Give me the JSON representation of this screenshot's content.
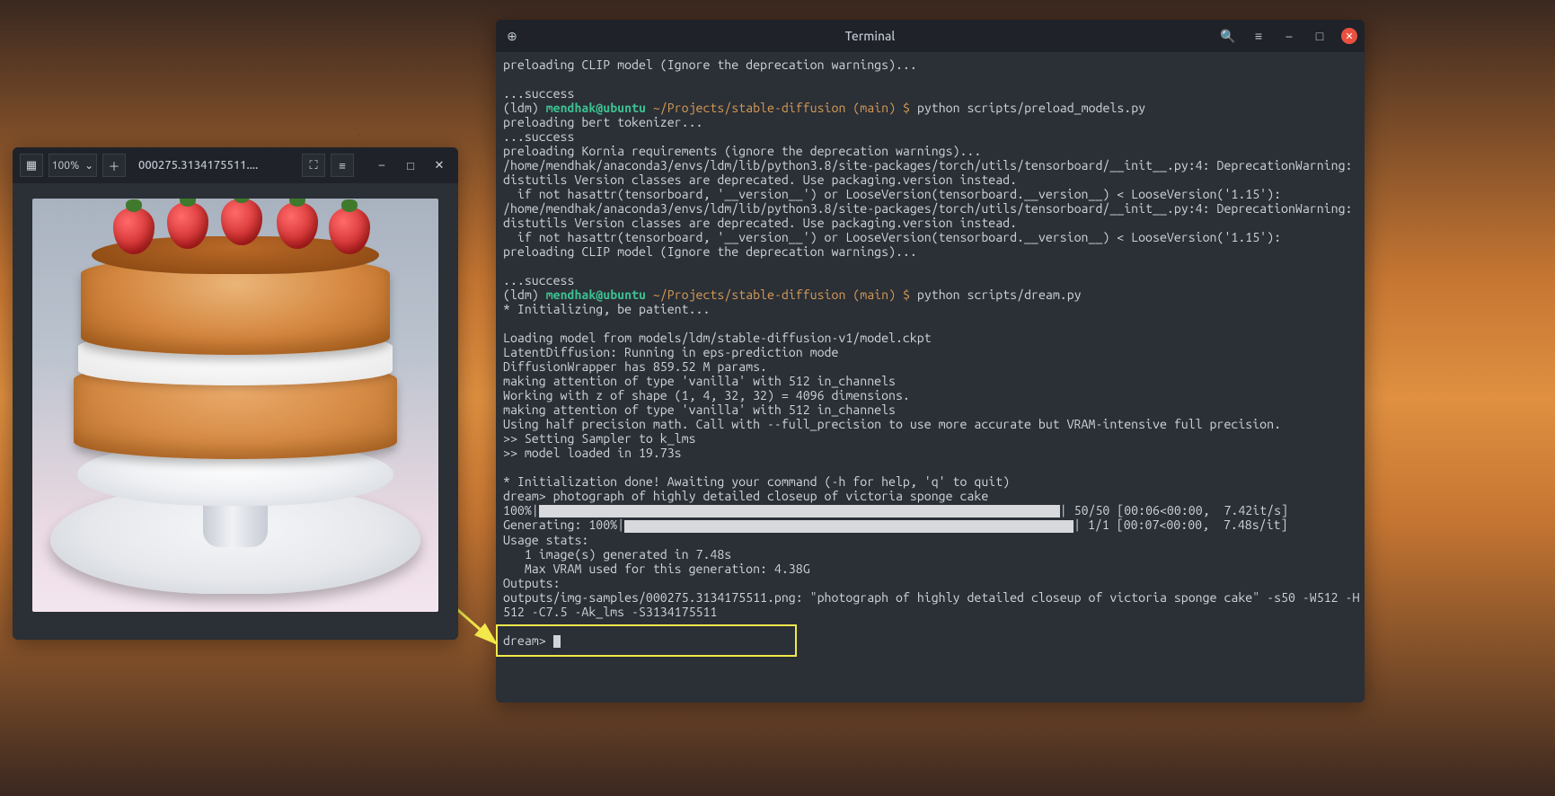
{
  "terminal": {
    "title": "Terminal",
    "prompt_env": "(ldm)",
    "prompt_userhost": "mendhak@ubuntu",
    "prompt_path": "~/Projects/stable-diffusion",
    "prompt_branch": "(main)",
    "prompt_symbol": "$",
    "lines": {
      "l01": "preloading CLIP model (Ignore the deprecation warnings)...",
      "l02": "",
      "l03": "...success",
      "cmd1": "python scripts/preload_models.py",
      "l05": "preloading bert tokenizer...",
      "l06": "...success",
      "l07": "preloading Kornia requirements (ignore the deprecation warnings)...",
      "l08": "/home/mendhak/anaconda3/envs/ldm/lib/python3.8/site-packages/torch/utils/tensorboard/__init__.py:4: DeprecationWarning:",
      "l09": "distutils Version classes are deprecated. Use packaging.version instead.",
      "l10": "  if not hasattr(tensorboard, '__version__') or LooseVersion(tensorboard.__version__) < LooseVersion('1.15'):",
      "l11": "/home/mendhak/anaconda3/envs/ldm/lib/python3.8/site-packages/torch/utils/tensorboard/__init__.py:4: DeprecationWarning:",
      "l12": "distutils Version classes are deprecated. Use packaging.version instead.",
      "l13": "  if not hasattr(tensorboard, '__version__') or LooseVersion(tensorboard.__version__) < LooseVersion('1.15'):",
      "l14": "preloading CLIP model (Ignore the deprecation warnings)...",
      "l15": "",
      "l16": "...success",
      "cmd2": "python scripts/dream.py",
      "l18": "* Initializing, be patient...",
      "l19": "",
      "l20": "Loading model from models/ldm/stable-diffusion-v1/model.ckpt",
      "l21": "LatentDiffusion: Running in eps-prediction mode",
      "l22": "DiffusionWrapper has 859.52 M params.",
      "l23": "making attention of type 'vanilla' with 512 in_channels",
      "l24": "Working with z of shape (1, 4, 32, 32) = 4096 dimensions.",
      "l25": "making attention of type 'vanilla' with 512 in_channels",
      "l26": "Using half precision math. Call with --full_precision to use more accurate but VRAM-intensive full precision.",
      "l27": ">> Setting Sampler to k_lms",
      "l28": ">> model loaded in 19.73s",
      "l29": "",
      "l30": "* Initialization done! Awaiting your command (-h for help, 'q' to quit)",
      "l31": "dream> photograph of highly detailed closeup of victoria sponge cake",
      "pb1_left": "100%|",
      "pb1_right": "| 50/50 [00:06<00:00,  7.42it/s]",
      "pb2_left": "Generating: 100%|",
      "pb2_right": "| 1/1 [00:07<00:00,  7.48s/it]",
      "l34": "Usage stats:",
      "l35": "   1 image(s) generated in 7.48s",
      "l36": "   Max VRAM used for this generation: 4.38G",
      "l37": "Outputs:",
      "l38a": "outputs/img-samples/000275.3134175511.png:",
      "l38b": " \"photograph of highly detailed closeup of victoria sponge cake\" -s50 -W512 -H",
      "l39": "512 -C7.5 -Ak_lms -S3134175511",
      "l40": "",
      "l41": "dream> "
    }
  },
  "viewer": {
    "zoom_label": "100%",
    "title": "000275.3134175511...."
  },
  "icons": {
    "new_tab": "⊕",
    "search": "🔍",
    "menu": "≡",
    "minimize": "–",
    "maximize": "□",
    "close": "✕",
    "grid": "▦",
    "plus": "＋",
    "fullscreen": "⛶",
    "dropdown": "⌄"
  }
}
